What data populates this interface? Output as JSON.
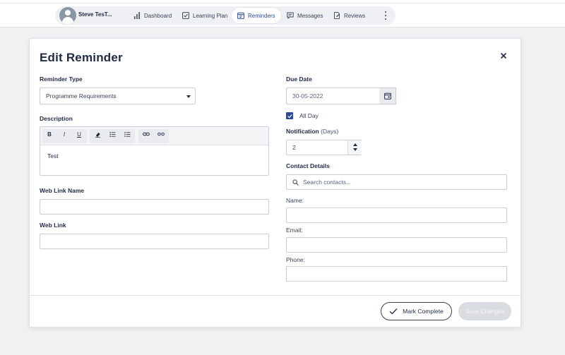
{
  "nav": {
    "user_name": "Steve TesT...",
    "items": [
      {
        "label": "Dashboard",
        "icon": "bar-chart-icon",
        "active": false
      },
      {
        "label": "Learning Plan",
        "icon": "checkbox-icon",
        "active": false
      },
      {
        "label": "Reminders",
        "icon": "calendar-icon",
        "active": true
      },
      {
        "label": "Messages",
        "icon": "chat-icon",
        "active": false
      },
      {
        "label": "Reviews",
        "icon": "review-icon",
        "active": false
      }
    ],
    "more_icon": "kebab-menu-icon"
  },
  "modal": {
    "title": "Edit Reminder",
    "close_icon": "close-icon",
    "reminder_type": {
      "label": "Reminder Type",
      "value": "Programme Requirements"
    },
    "description": {
      "label": "Description",
      "toolbar": [
        {
          "text": "B",
          "name": "bold-button"
        },
        {
          "text": "I",
          "name": "italic-button"
        },
        {
          "text": "U",
          "name": "underline-button"
        }
      ],
      "content": "Test"
    },
    "web_link_name": {
      "label": "Web Link Name",
      "value": ""
    },
    "web_link": {
      "label": "Web Link",
      "value": ""
    },
    "due_date": {
      "label": "Due Date",
      "value": "30-05-2022"
    },
    "all_day": {
      "label": "All Day",
      "checked": true
    },
    "notification": {
      "label": "Notification",
      "unit": "(Days)",
      "value": "2"
    },
    "contact_details": {
      "label": "Contact Details",
      "search_placeholder": "Search contacts..."
    },
    "name": {
      "label": "Name:",
      "value": ""
    },
    "email": {
      "label": "Email:",
      "value": ""
    },
    "phone": {
      "label": "Phone:",
      "value": ""
    },
    "buttons": {
      "mark_complete": "Mark Complete",
      "save_changes": "Save Changes"
    }
  },
  "colors": {
    "accent": "#2c4a9a",
    "text": "#1f2a44",
    "background": "#f0f1f3",
    "disabled_button": "#d9dce1"
  }
}
